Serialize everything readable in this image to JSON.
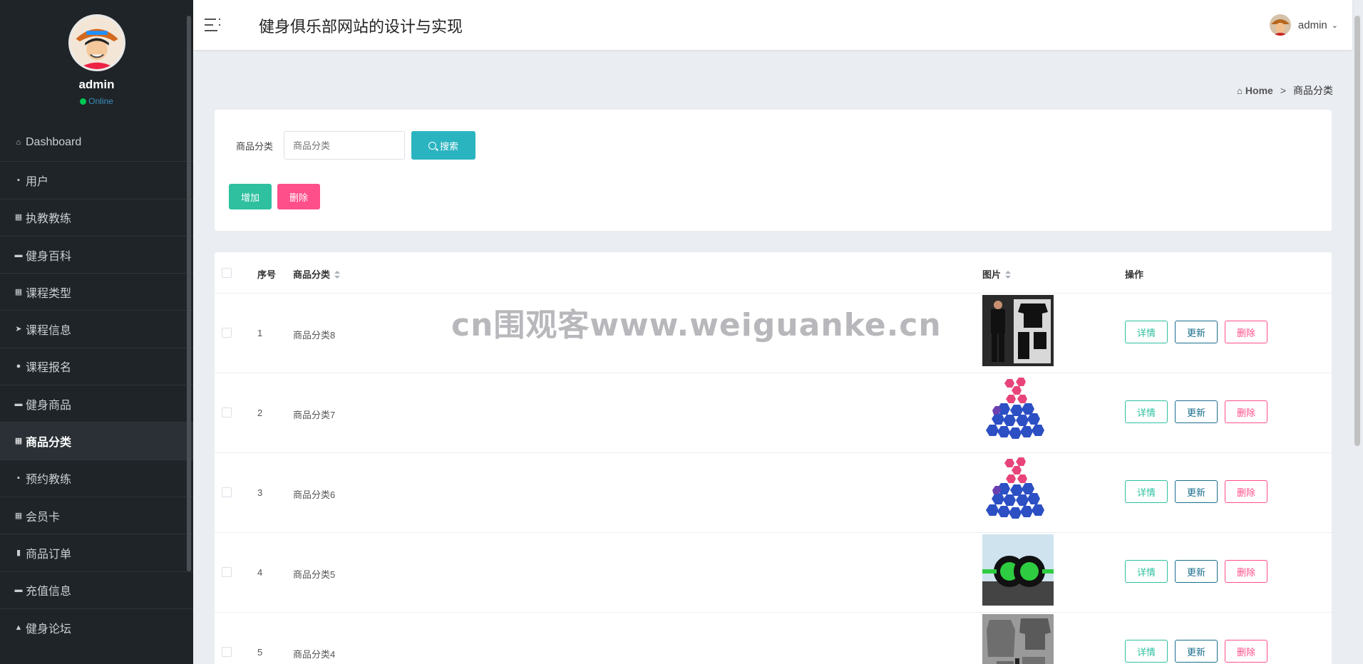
{
  "sidebar": {
    "username": "admin",
    "status": "Online",
    "items": [
      {
        "label": "Dashboard",
        "icon": "home-icon",
        "glyph": "⌂"
      },
      {
        "label": "用户",
        "icon": "user-icon",
        "glyph": "▪"
      },
      {
        "label": "执教教练",
        "icon": "grid-icon",
        "glyph": "▦"
      },
      {
        "label": "健身百科",
        "icon": "briefcase-icon",
        "glyph": "▬"
      },
      {
        "label": "课程类型",
        "icon": "grid-icon",
        "glyph": "▦"
      },
      {
        "label": "课程信息",
        "icon": "send-icon",
        "glyph": "➤"
      },
      {
        "label": "课程报名",
        "icon": "pin-icon",
        "glyph": "●"
      },
      {
        "label": "健身商品",
        "icon": "card-icon",
        "glyph": "▬"
      },
      {
        "label": "商品分类",
        "icon": "grid-icon",
        "glyph": "▦",
        "active": true
      },
      {
        "label": "预约教练",
        "icon": "doc-icon",
        "glyph": "▪"
      },
      {
        "label": "会员卡",
        "icon": "apps-icon",
        "glyph": "▦"
      },
      {
        "label": "商品订单",
        "icon": "chart-icon",
        "glyph": "▮"
      },
      {
        "label": "充值信息",
        "icon": "chat-icon",
        "glyph": "▬"
      },
      {
        "label": "健身论坛",
        "icon": "person-icon",
        "glyph": "▲"
      }
    ]
  },
  "header": {
    "title": "健身俱乐部网站的设计与实现",
    "user": "admin"
  },
  "breadcrumb": {
    "home": "Home",
    "sep": ">",
    "current": "商品分类"
  },
  "search": {
    "label": "商品分类",
    "placeholder": "商品分类",
    "button": "搜索"
  },
  "actions": {
    "add": "增加",
    "delete": "删除"
  },
  "table": {
    "headers": {
      "index": "序号",
      "category": "商品分类",
      "image": "图片",
      "ops": "操作"
    },
    "rows": [
      {
        "index": "1",
        "category": "商品分类8",
        "image": "sportswear"
      },
      {
        "index": "2",
        "category": "商品分类7",
        "image": "dumbbells"
      },
      {
        "index": "3",
        "category": "商品分类6",
        "image": "dumbbells"
      },
      {
        "index": "4",
        "category": "商品分类5",
        "image": "ab-roller"
      },
      {
        "index": "5",
        "category": "商品分类4",
        "image": "gym-clothes"
      }
    ],
    "row_actions": {
      "detail": "详情",
      "update": "更新",
      "remove": "删除"
    }
  },
  "watermark": "cn围观客www.weiguanke.cn",
  "colors": {
    "sidebar_bg": "#1f2428",
    "search_btn": "#2ab4c0",
    "add_btn": "#2ec09f",
    "delete_btn": "#ff4f8b",
    "update_btn": "#1a6e8e"
  }
}
